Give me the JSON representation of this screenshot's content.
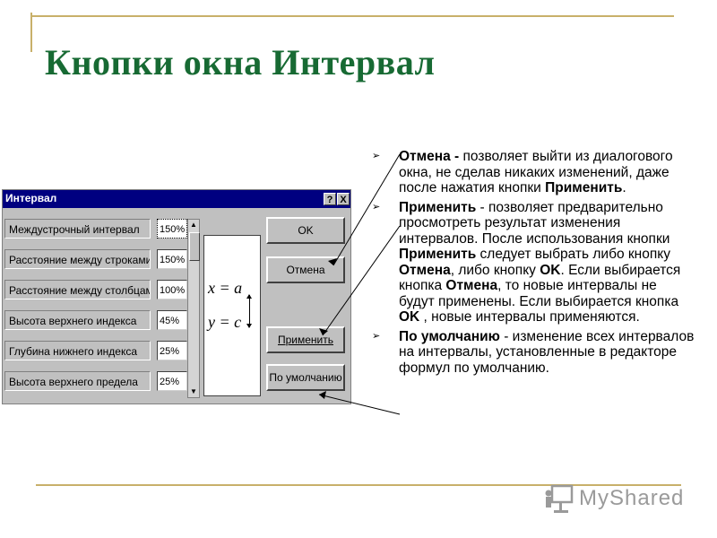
{
  "slide": {
    "title": "Кнопки окна Интервал"
  },
  "dialog": {
    "title": "Интервал",
    "help_btn": "?",
    "close_btn": "X",
    "rows": [
      {
        "label": "Междустрочный интервал",
        "value": "150%"
      },
      {
        "label": "Расстояние между строками",
        "value": "150%"
      },
      {
        "label": "Расстояние между столбцами",
        "value": "100%"
      },
      {
        "label": "Высота верхнего индекса",
        "value": "45%"
      },
      {
        "label": "Глубина нижнего индекса",
        "value": "25%"
      },
      {
        "label": "Высота верхнего предела",
        "value": "25%"
      }
    ],
    "preview": {
      "eq1": "x = a",
      "eq2": "y = c"
    },
    "buttons": {
      "ok": "OK",
      "cancel": "Отмена",
      "apply": "Применить",
      "default": "По умолчанию"
    }
  },
  "bullets": [
    {
      "strong": "Отмена -",
      "text": " позволяет выйти из диалогового окна, не сделав никаких изменений, даже после нажатия кнопки ",
      "strong2": "Применить",
      "tail": "."
    },
    {
      "strong": "Применить",
      "text": " - позволяет предварительно просмотреть результат изменения интервалов. После использования кнопки ",
      "strong2": "Применить",
      "text2": " следует выбрать либо кнопку ",
      "strong3": "Отмена",
      "text3": ", либо кнопку ",
      "strong4": "OK",
      "text4": ". Если выбирается кнопка ",
      "strong5": "Отмена",
      "text5": ", то новые интервалы не будут применены. Если выбирается кнопка ",
      "strong6": "OK",
      "text6": " , новые интервалы применяются."
    },
    {
      "strong": "По умолчанию",
      "text": " - изменение всех интервалов на интервалы, установленные в редакторе формул по умолчанию."
    }
  ],
  "logo": {
    "text": "MyShared",
    "icon": "teacher-board-icon"
  }
}
